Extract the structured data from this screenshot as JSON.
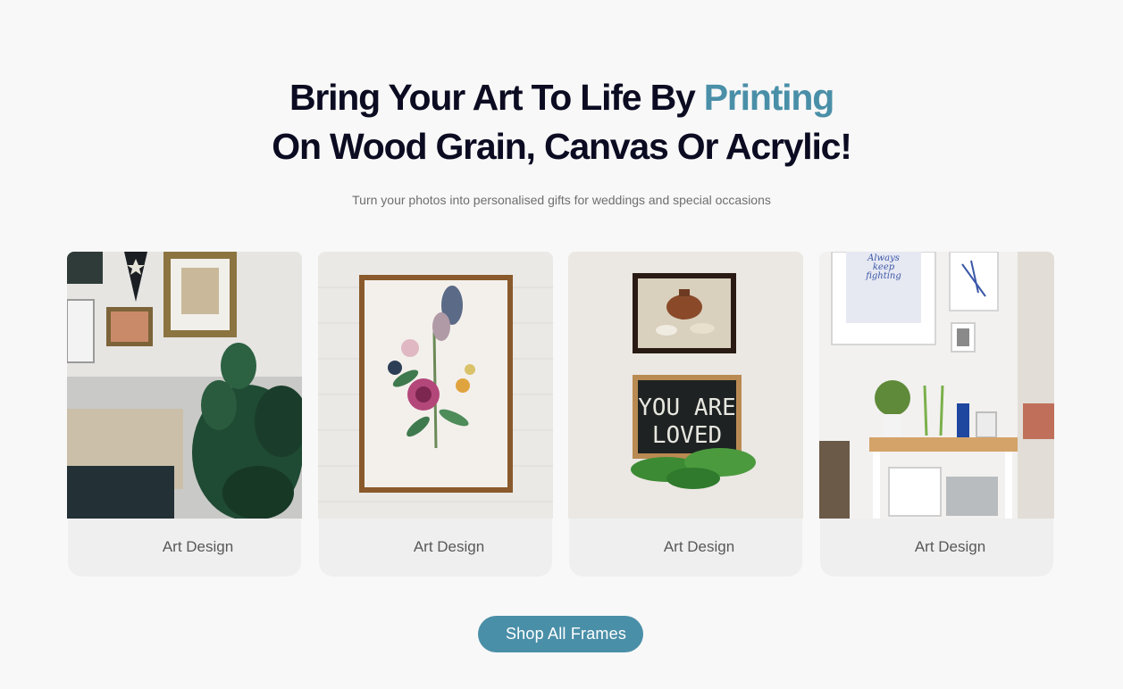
{
  "hero": {
    "title_part1": "Bring Your Art To Life By ",
    "title_accent": "Printing",
    "title_part2": " On Wood Grain, Canvas Or Acrylic!",
    "subtitle": "Turn your photos into personalised gifts for weddings and special occasions"
  },
  "cards": [
    {
      "caption": "Art Design",
      "image": "living-room-wall-frames-plant"
    },
    {
      "caption": "Art Design",
      "image": "botanical-print-gold-frame"
    },
    {
      "caption": "Art Design",
      "image": "still-life-frame-chalkboard"
    },
    {
      "caption": "Art Design",
      "image": "bright-room-frames-table"
    }
  ],
  "chalkboard": {
    "line1": "YOU ARE",
    "line2": "LOVED"
  },
  "poster_text": {
    "line1": "Always",
    "line2": "keep",
    "line3": "fighting"
  },
  "cta": {
    "label": "Shop All Frames"
  },
  "colors": {
    "accent": "#4a8fa8",
    "heading": "#0b0b22",
    "background": "#f8f8f8",
    "caption_bg": "#efefef"
  }
}
